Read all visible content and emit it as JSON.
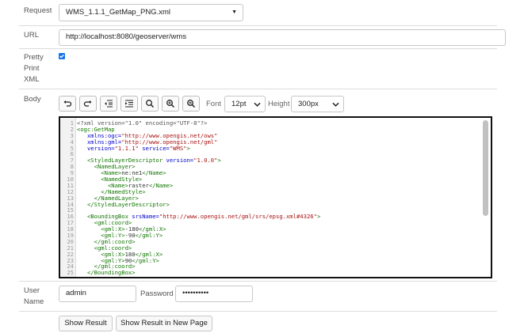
{
  "labels": {
    "request": "Request",
    "url": "URL",
    "pretty_print_1": "Pretty",
    "pretty_print_2": "Print",
    "pretty_print_3": "XML",
    "body": "Body",
    "user_name_1": "User",
    "user_name_2": "Name",
    "password": "Password"
  },
  "request": {
    "selected": "WMS_1.1.1_GetMap_PNG.xml"
  },
  "url": {
    "value": "http://localhost:8080/geoserver/wms"
  },
  "pretty_print": {
    "checked": true
  },
  "toolbar": {
    "icons": [
      "undo-icon",
      "redo-icon",
      "indent-less-icon",
      "indent-more-icon",
      "search-icon",
      "zoom-in-icon",
      "replace-icon"
    ],
    "font_label": "Font",
    "font_value": "12pt",
    "height_label": "Height",
    "height_value": "300px"
  },
  "editor": {
    "lines": [
      [
        [
          "m",
          "<?xml version=\"1.0\" encoding=\"UTF-8\"?>"
        ]
      ],
      [
        [
          "t",
          "<ogc:GetMap"
        ]
      ],
      [
        [
          "tx",
          "   "
        ],
        [
          "a",
          "xmlns:ogc="
        ],
        [
          "s",
          "\"http://www.opengis.net/ows\""
        ]
      ],
      [
        [
          "tx",
          "   "
        ],
        [
          "a",
          "xmlns:gml="
        ],
        [
          "s",
          "\"http://www.opengis.net/gml\""
        ]
      ],
      [
        [
          "tx",
          "   "
        ],
        [
          "a",
          "version="
        ],
        [
          "s",
          "\"1.1.1\""
        ],
        [
          "tx",
          " "
        ],
        [
          "a",
          "service="
        ],
        [
          "s",
          "\"WMS\""
        ],
        [
          "t",
          ">"
        ]
      ],
      [
        [
          "tx",
          ""
        ]
      ],
      [
        [
          "tx",
          "   "
        ],
        [
          "t",
          "<StyledLayerDescriptor"
        ],
        [
          "tx",
          " "
        ],
        [
          "a",
          "version="
        ],
        [
          "s",
          "\"1.0.0\""
        ],
        [
          "t",
          ">"
        ]
      ],
      [
        [
          "tx",
          "     "
        ],
        [
          "t",
          "<NamedLayer>"
        ]
      ],
      [
        [
          "tx",
          "       "
        ],
        [
          "t",
          "<Name>"
        ],
        [
          "tx",
          "ne:ne1"
        ],
        [
          "t",
          "</Name>"
        ]
      ],
      [
        [
          "tx",
          "       "
        ],
        [
          "t",
          "<NamedStyle>"
        ]
      ],
      [
        [
          "tx",
          "         "
        ],
        [
          "t",
          "<Name>"
        ],
        [
          "tx",
          "raster"
        ],
        [
          "t",
          "</Name>"
        ]
      ],
      [
        [
          "tx",
          "       "
        ],
        [
          "t",
          "</NamedStyle>"
        ]
      ],
      [
        [
          "tx",
          "     "
        ],
        [
          "t",
          "</NamedLayer>"
        ]
      ],
      [
        [
          "tx",
          "   "
        ],
        [
          "t",
          "</StyledLayerDescriptor>"
        ]
      ],
      [
        [
          "tx",
          ""
        ]
      ],
      [
        [
          "tx",
          "   "
        ],
        [
          "t",
          "<BoundingBox"
        ],
        [
          "tx",
          " "
        ],
        [
          "a",
          "srsName="
        ],
        [
          "s",
          "\"http://www.opengis.net/gml/srs/epsg.xml#4326\""
        ],
        [
          "t",
          ">"
        ]
      ],
      [
        [
          "tx",
          "     "
        ],
        [
          "t",
          "<gml:coord>"
        ]
      ],
      [
        [
          "tx",
          "       "
        ],
        [
          "t",
          "<gml:X>"
        ],
        [
          "tx",
          "-180"
        ],
        [
          "t",
          "</gml:X>"
        ]
      ],
      [
        [
          "tx",
          "       "
        ],
        [
          "t",
          "<gml:Y>"
        ],
        [
          "tx",
          "-90"
        ],
        [
          "t",
          "</gml:Y>"
        ]
      ],
      [
        [
          "tx",
          "     "
        ],
        [
          "t",
          "</gml:coord>"
        ]
      ],
      [
        [
          "tx",
          "     "
        ],
        [
          "t",
          "<gml:coord>"
        ]
      ],
      [
        [
          "tx",
          "       "
        ],
        [
          "t",
          "<gml:X>"
        ],
        [
          "tx",
          "180"
        ],
        [
          "t",
          "</gml:X>"
        ]
      ],
      [
        [
          "tx",
          "       "
        ],
        [
          "t",
          "<gml:Y>"
        ],
        [
          "tx",
          "90"
        ],
        [
          "t",
          "</gml:Y>"
        ]
      ],
      [
        [
          "tx",
          "     "
        ],
        [
          "t",
          "</gml:coord>"
        ]
      ],
      [
        [
          "tx",
          "   "
        ],
        [
          "t",
          "</BoundingBox>"
        ]
      ]
    ]
  },
  "user_name": {
    "value": "admin"
  },
  "password": {
    "value": "••••••••••"
  },
  "buttons": {
    "show_result": "Show Result",
    "show_result_new_page": "Show Result in New Page"
  }
}
